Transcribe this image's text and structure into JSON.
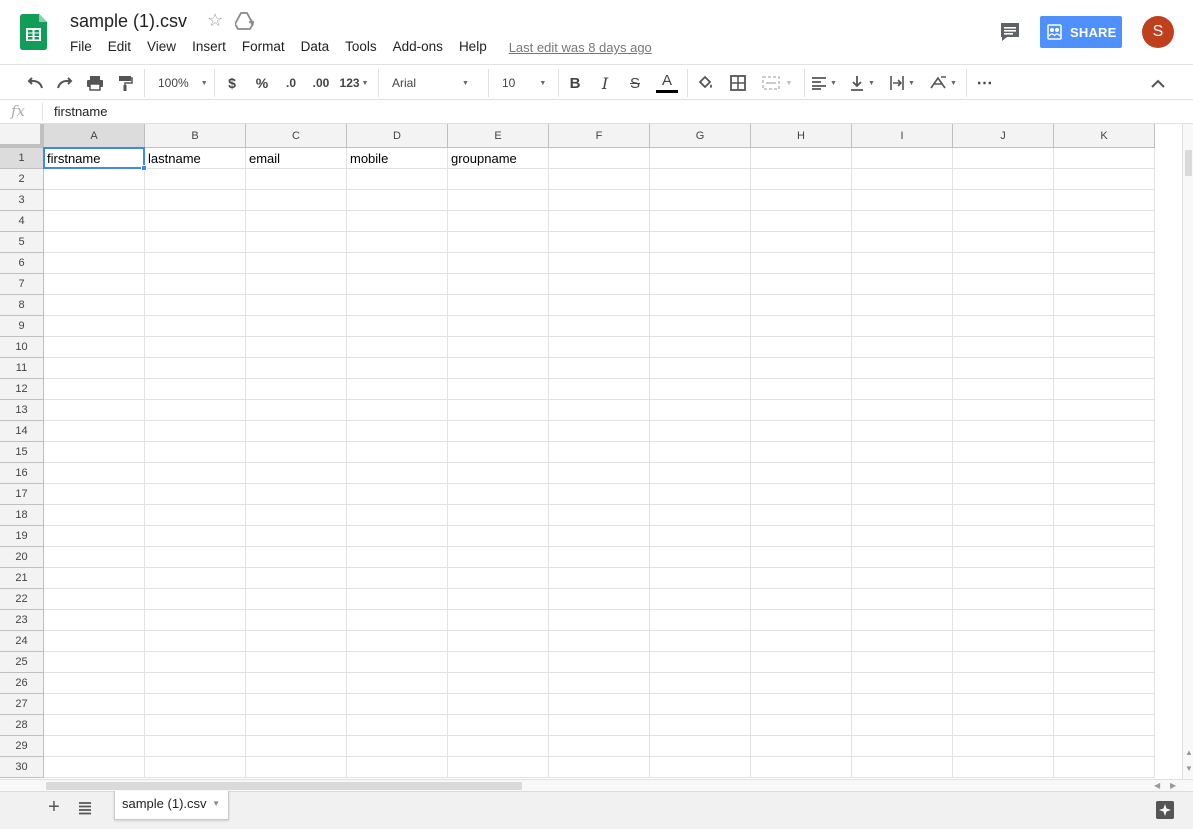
{
  "doc": {
    "title": "sample (1).csv",
    "last_edit": "Last edit was 8 days ago"
  },
  "menus": [
    "File",
    "Edit",
    "View",
    "Insert",
    "Format",
    "Data",
    "Tools",
    "Add-ons",
    "Help"
  ],
  "share": {
    "label": "SHARE"
  },
  "user": {
    "initial": "S"
  },
  "toolbar": {
    "zoom": "100%",
    "currency": "$",
    "percent": "%",
    "dec_dec": ".0",
    "inc_dec": ".00",
    "more_formats": "123",
    "font": "Arial",
    "font_size": "10",
    "more": "⋯"
  },
  "formula_bar": {
    "fx": "fx",
    "value": "firstname"
  },
  "columns": [
    "A",
    "B",
    "C",
    "D",
    "E",
    "F",
    "G",
    "H",
    "I",
    "J",
    "K"
  ],
  "rows": [
    1,
    2,
    3,
    4,
    5,
    6,
    7,
    8,
    9,
    10,
    11,
    12,
    13,
    14,
    15,
    16,
    17,
    18,
    19,
    20,
    21,
    22,
    23,
    24,
    25,
    26,
    27,
    28,
    29,
    30
  ],
  "cells": {
    "A1": "firstname",
    "B1": "lastname",
    "C1": "email",
    "D1": "mobile",
    "E1": "groupname"
  },
  "selected_cell": "A1",
  "sheet_tabs": [
    {
      "name": "sample (1).csv"
    }
  ],
  "colors": {
    "share_blue": "#4d90fe",
    "avatar": "#c0401d",
    "selection": "#4285f4",
    "sheets_green": "#0f9d58"
  },
  "icons": [
    "undo-icon",
    "redo-icon",
    "print-icon",
    "paint-format-icon",
    "bold-icon",
    "italic-icon",
    "strikethrough-icon",
    "text-color-icon",
    "fill-color-icon",
    "borders-icon",
    "merge-icon",
    "align-icon",
    "valign-icon",
    "text-wrap-icon",
    "text-rotate-icon",
    "collapse-icon",
    "comment-icon",
    "star-icon",
    "drive-icon",
    "explore-icon"
  ]
}
